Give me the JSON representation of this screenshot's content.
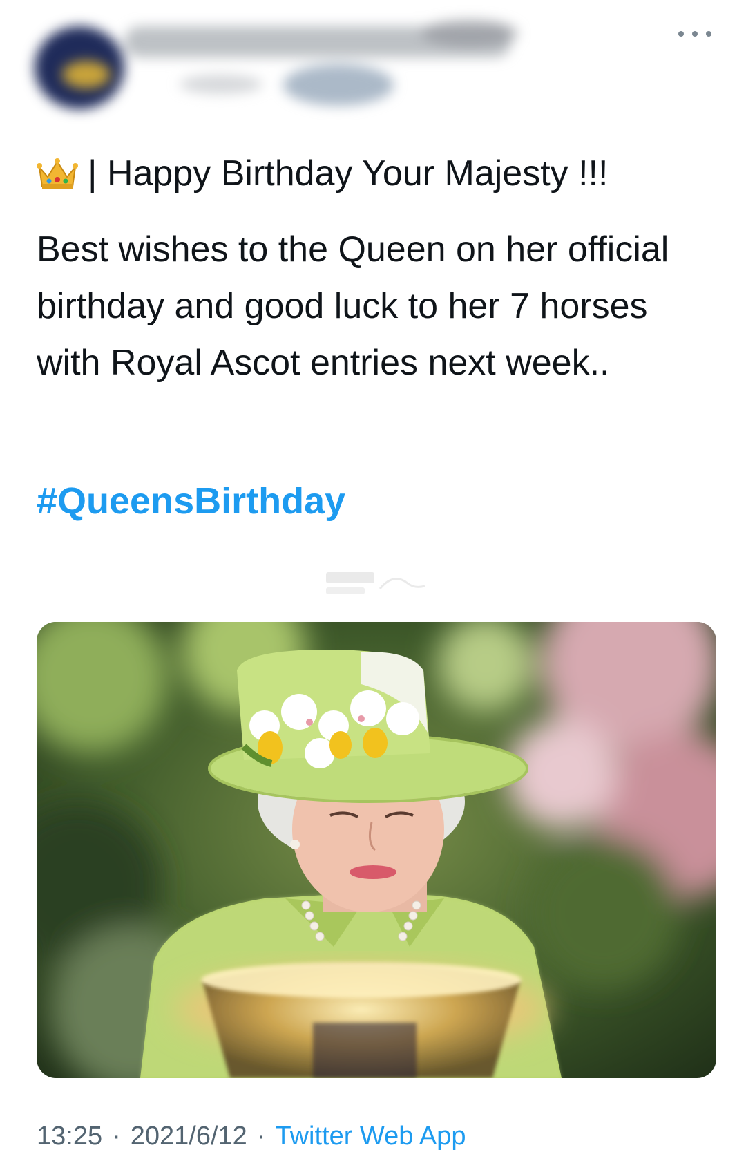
{
  "header": {
    "more_icon": "more-horizontal-icon"
  },
  "tweet": {
    "title_icon": "crown-emoji-icon",
    "title": "| Happy Birthday Your Majesty !!!",
    "body": "Best wishes to the Queen on her official birthday and good luck to her 7 horses with Royal Ascot entries next week..",
    "hashtag": "#QueensBirthday",
    "photo_icon": "photo-queen-in-green-hat"
  },
  "meta": {
    "time": "13:25",
    "separator": "·",
    "date": "2021/6/12",
    "source": "Twitter Web App"
  },
  "colors": {
    "text": "#0f1419",
    "secondary": "#536471",
    "link": "#1d9bf0"
  }
}
